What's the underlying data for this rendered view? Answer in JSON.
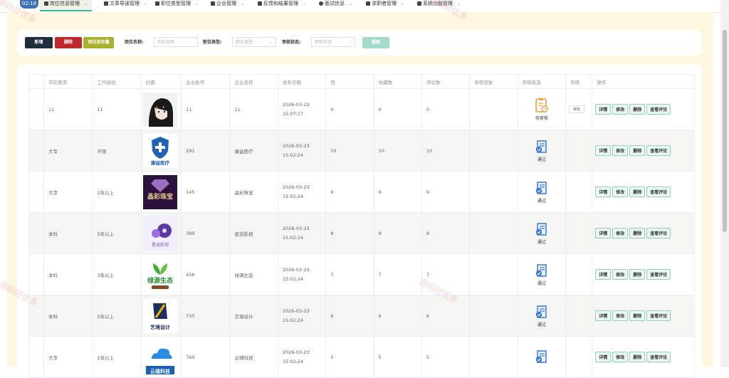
{
  "clock": "02:18",
  "nav": [
    {
      "label": "岗位信息管理",
      "active": true
    },
    {
      "label": "文章导读管理",
      "active": false
    },
    {
      "label": "职位类型管理",
      "active": false
    },
    {
      "label": "企业管理",
      "active": false
    },
    {
      "label": "反馈和结果管理",
      "active": false
    },
    {
      "label": "面试信息",
      "active": false
    },
    {
      "label": "求职者管理",
      "active": false
    },
    {
      "label": "系统功能管理",
      "active": false
    }
  ],
  "toolbar": {
    "add": "新增",
    "delete": "删除",
    "publish": "岗位发布量",
    "name_label": "岗位名称:",
    "name_placeholder": "岗位名称",
    "type_label": "职位类型:",
    "type_placeholder": "职位类型",
    "audit_label": "审核状态:",
    "audit_placeholder": "审核状态",
    "search": "搜索"
  },
  "table": {
    "headers": [
      "",
      "学历要求",
      "工作经验",
      "封面",
      "企业账号",
      "企业名称",
      "发布日期",
      "赞",
      "收藏数",
      "评论数",
      "审核回复",
      "审核状态",
      "审核",
      "操作"
    ],
    "audit_btn": "审核",
    "ops": [
      "详情",
      "修改",
      "删除",
      "查看评论"
    ],
    "rows": [
      {
        "edu": "11",
        "exp": "11",
        "cover": "anime",
        "account": "11",
        "company": "11",
        "date": "2026-03-23 15:07:17",
        "likes": "0",
        "favs": "0",
        "comments": "0",
        "reply": "",
        "status": "待审核",
        "pending": true
      },
      {
        "edu": "大专",
        "exp": "不限",
        "cover": "康益医疗",
        "account": "291",
        "company": "康益医疗",
        "date": "2026-03-23 15:02:24",
        "likes": "10",
        "favs": "10",
        "comments": "10",
        "reply": "",
        "status": "通过",
        "pending": false
      },
      {
        "edu": "大专",
        "exp": "2年以上",
        "cover": "晶彩珠宝",
        "account": "145",
        "company": "晶彩珠宝",
        "date": "2026-03-23 15:02:24",
        "likes": "9",
        "favs": "9",
        "comments": "9",
        "reply": "",
        "status": "通过",
        "pending": false
      },
      {
        "edu": "本科",
        "exp": "5年以上",
        "cover": "星途影视",
        "account": "389",
        "company": "星途影视",
        "date": "2026-03-23 15:02:24",
        "likes": "8",
        "favs": "8",
        "comments": "8",
        "reply": "",
        "status": "通过",
        "pending": false
      },
      {
        "edu": "本科",
        "exp": "3年以上",
        "cover": "绿源生态",
        "account": "456",
        "company": "绿源生态",
        "date": "2026-03-23 15:02:24",
        "likes": "7",
        "favs": "7",
        "comments": "7",
        "reply": "",
        "status": "通过",
        "pending": false
      },
      {
        "edu": "本科",
        "exp": "5年以上",
        "cover": "艺境设计",
        "account": "735",
        "company": "艺境设计",
        "date": "2026-03-23 15:02:24",
        "likes": "6",
        "favs": "6",
        "comments": "6",
        "reply": "",
        "status": "通过",
        "pending": false
      },
      {
        "edu": "大专",
        "exp": "1年以上",
        "cover": "云禧科技",
        "account": "769",
        "company": "云禧科技",
        "date": "2026-03-23 15:02:24",
        "likes": "5",
        "favs": "5",
        "comments": "5",
        "reply": "",
        "status": "",
        "pending": false
      }
    ]
  },
  "watermark": "源码好优多",
  "colors": {
    "add": "#1f2d3d",
    "delete": "#c0282b",
    "publish": "#a8b32c",
    "search": "#a3dccd",
    "pending": "#e6a23c",
    "pass": "#3a7bd5"
  }
}
